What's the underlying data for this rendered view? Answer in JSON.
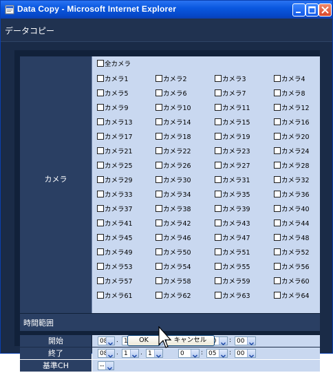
{
  "window": {
    "title": "Data Copy - Microsoft Internet Explorer"
  },
  "page": {
    "title": "データコピー"
  },
  "camera": {
    "section_label": "カメラ",
    "all_label": "全カメラ",
    "cameras": [
      "カメラ1",
      "カメラ2",
      "カメラ3",
      "カメラ4",
      "カメラ5",
      "カメラ6",
      "カメラ7",
      "カメラ8",
      "カメラ9",
      "カメラ10",
      "カメラ11",
      "カメラ12",
      "カメラ13",
      "カメラ14",
      "カメラ15",
      "カメラ16",
      "カメラ17",
      "カメラ18",
      "カメラ19",
      "カメラ20",
      "カメラ21",
      "カメラ22",
      "カメラ23",
      "カメラ24",
      "カメラ25",
      "カメラ26",
      "カメラ27",
      "カメラ28",
      "カメラ29",
      "カメラ30",
      "カメラ31",
      "カメラ32",
      "カメラ33",
      "カメラ34",
      "カメラ35",
      "カメラ36",
      "カメラ37",
      "カメラ38",
      "カメラ39",
      "カメラ40",
      "カメラ41",
      "カメラ42",
      "カメラ43",
      "カメラ44",
      "カメラ45",
      "カメラ46",
      "カメラ47",
      "カメラ48",
      "カメラ49",
      "カメラ50",
      "カメラ51",
      "カメラ52",
      "カメラ53",
      "カメラ54",
      "カメラ55",
      "カメラ56",
      "カメラ57",
      "カメラ58",
      "カメラ59",
      "カメラ60",
      "カメラ61",
      "カメラ62",
      "カメラ63",
      "カメラ64"
    ]
  },
  "time_range": {
    "header": "時間範囲",
    "start": {
      "label": "開始",
      "year": "08",
      "month": "1",
      "day": "1",
      "hour": "0",
      "minute": "00",
      "second": "00"
    },
    "end": {
      "label": "終了",
      "year": "08",
      "month": "1",
      "day": "1",
      "hour": "0",
      "minute": "05",
      "second": "00"
    },
    "separators": {
      "date": ".",
      "time": ":"
    }
  },
  "base_ch": {
    "label": "基準CH",
    "value": "--"
  },
  "buttons": {
    "ok": "OK",
    "cancel": "キャンセル"
  },
  "colors": {
    "titlebar": "#0a58e0",
    "label_bg": "#2a3f63",
    "field_bg": "#c9d8f0",
    "page_bg": "#11213a"
  }
}
